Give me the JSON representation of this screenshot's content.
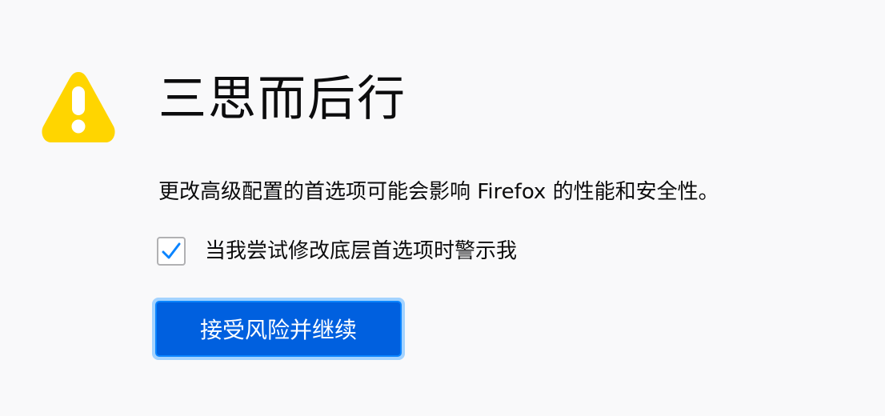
{
  "warning": {
    "icon": "warning-triangle-icon",
    "color": "#ffd500"
  },
  "title": "三思而后行",
  "description": "更改高级配置的首选项可能会影响 Firefox 的性能和安全性。",
  "checkbox": {
    "label": "当我尝试修改底层首选项时警示我",
    "checked": true,
    "check_color": "#0a84ff"
  },
  "accept_button": {
    "label": "接受风险并继续",
    "color": "#0060df",
    "focus_ring_color": "#a3d3ff"
  }
}
